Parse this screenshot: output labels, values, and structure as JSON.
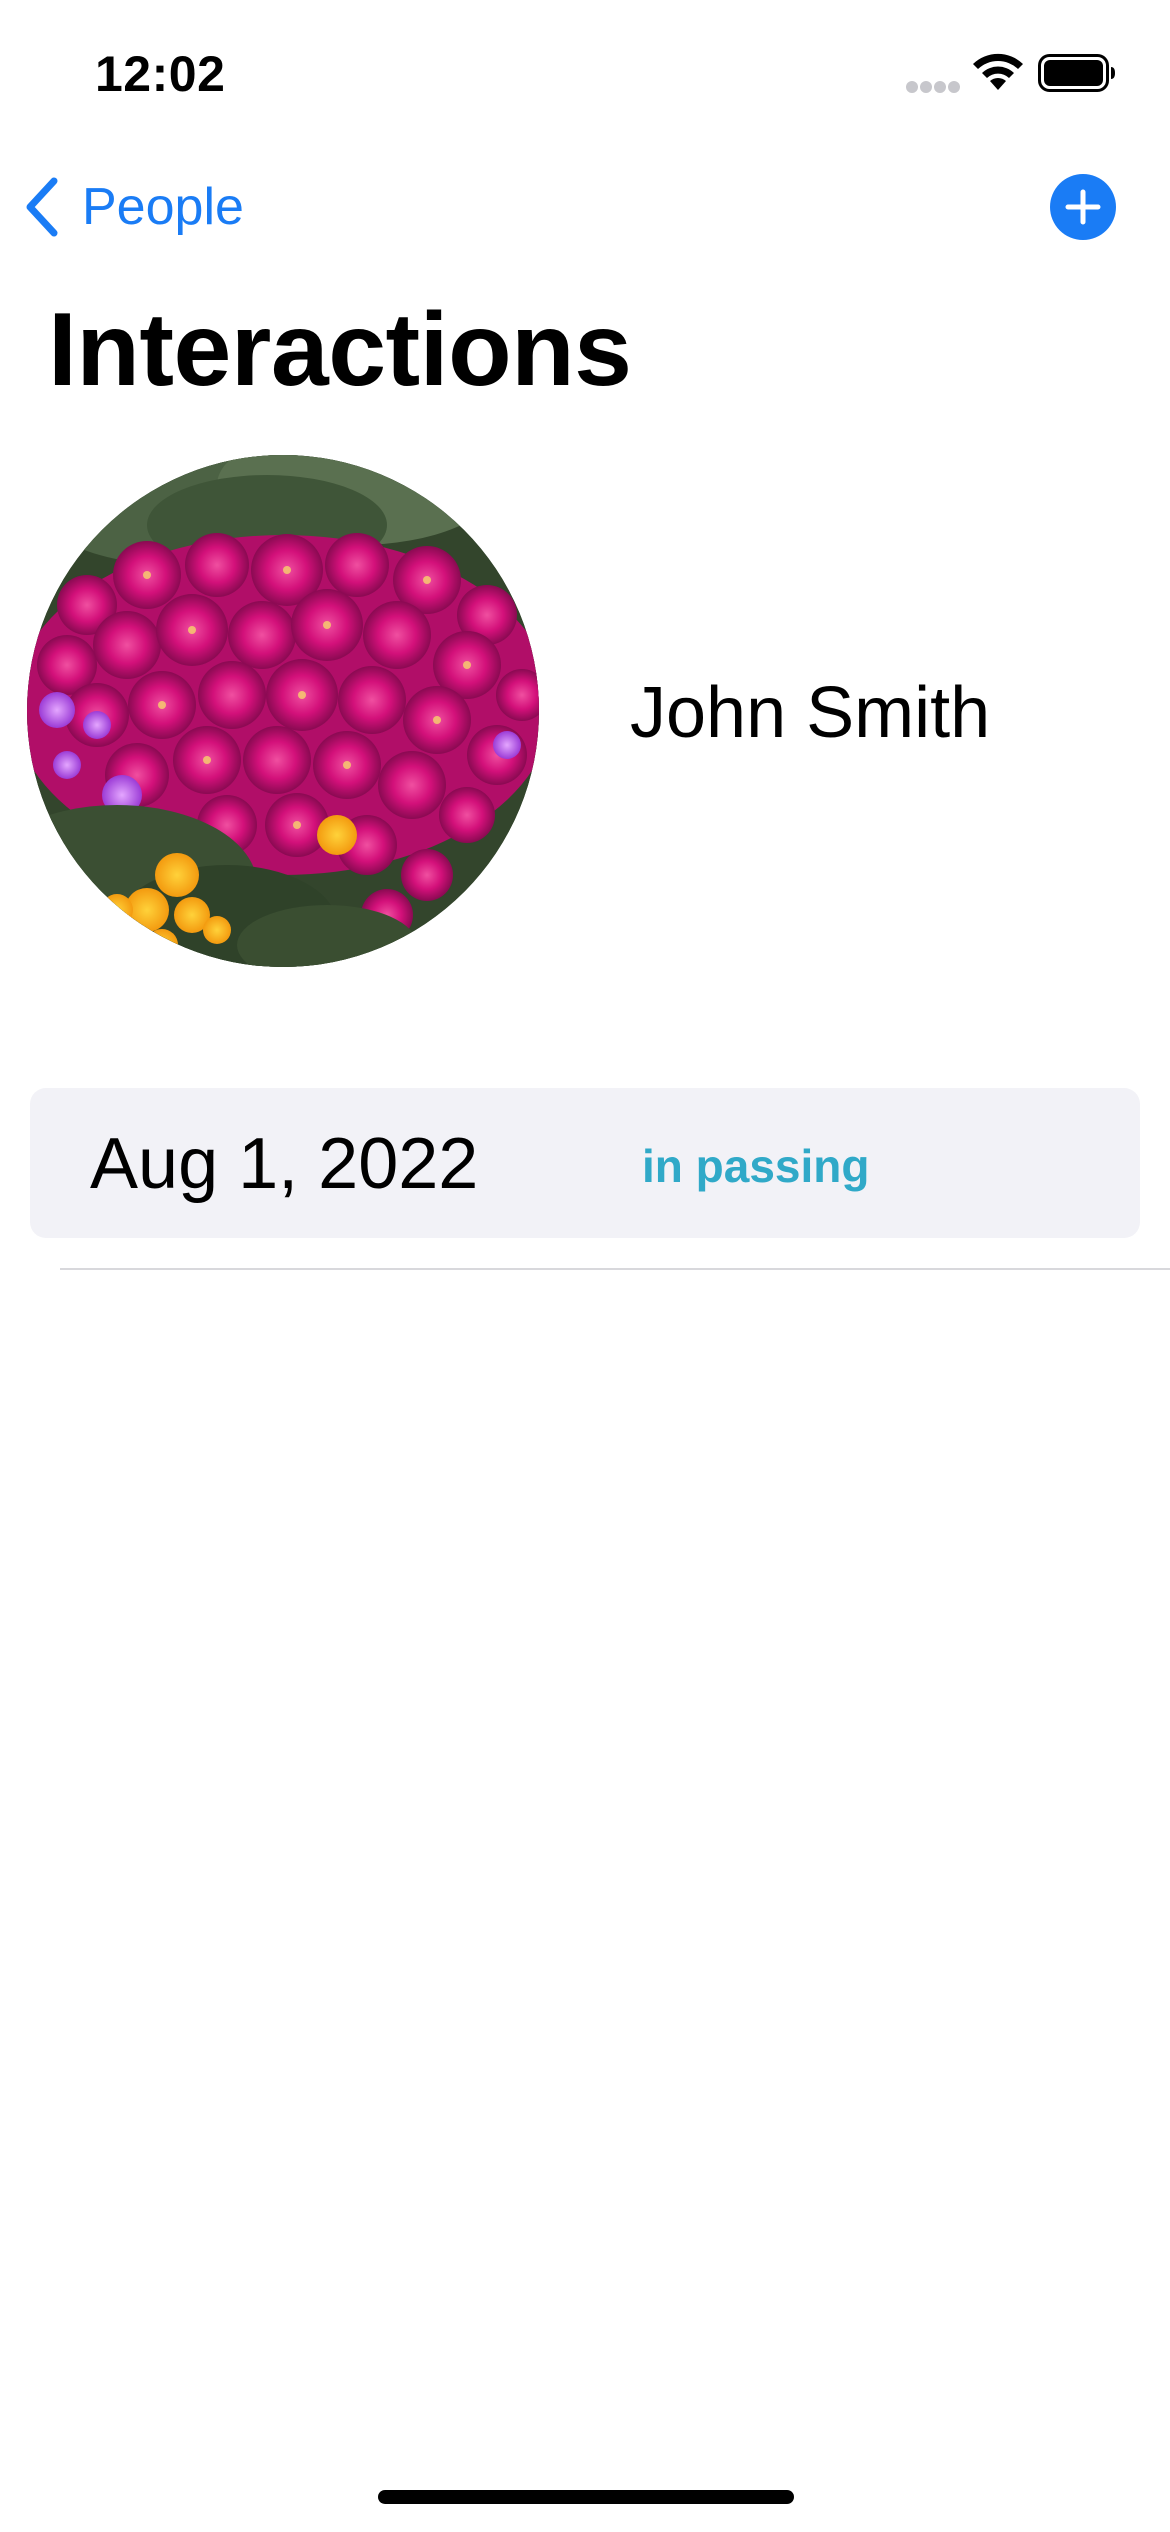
{
  "status_bar": {
    "time": "12:02",
    "icons": [
      "cellular-signal-icon",
      "wifi-icon",
      "battery-icon"
    ]
  },
  "nav": {
    "back_label": "People",
    "back_icon": "chevron-left-icon",
    "add_icon": "plus-circle-icon"
  },
  "page": {
    "title": "Interactions"
  },
  "person": {
    "name": "John Smith",
    "avatar_icon": "flower-photo"
  },
  "interactions": [
    {
      "date": "Aug 1, 2022",
      "type": "in passing"
    }
  ],
  "colors": {
    "accent": "#1a7cf5",
    "interaction_type": "#30a9c8",
    "row_background": "#f2f2f7"
  }
}
